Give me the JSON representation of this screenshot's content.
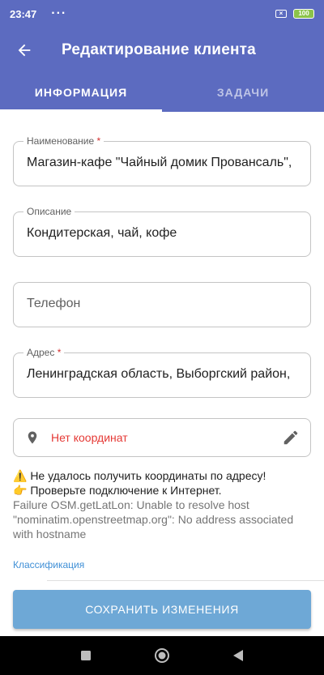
{
  "status_bar": {
    "time": "23:47",
    "dots": "···",
    "battery": "100"
  },
  "app_bar": {
    "title": "Редактирование клиента",
    "back_icon": "arrow-left-icon"
  },
  "tabs": [
    {
      "label": "ИНФОРМАЦИЯ",
      "active": true
    },
    {
      "label": "ЗАДАЧИ",
      "active": false
    }
  ],
  "form": {
    "name": {
      "label": "Наименование",
      "required": "*",
      "value": "Магазин-кафе \"Чайный домик Провансаль\","
    },
    "description": {
      "label": "Описание",
      "value": "Кондитерская, чай, кофе"
    },
    "phone": {
      "placeholder": "Телефон"
    },
    "address": {
      "label": "Адрес",
      "required": "*",
      "value": "Ленинградская область, Выборгский район,"
    },
    "coordinates": {
      "text": "Нет координат",
      "icon": "location-pin-icon",
      "edit_icon": "pencil-icon"
    }
  },
  "message": {
    "line1": "⚠️ Не удалось получить координаты по адресу!",
    "line2": "👉 Проверьте подключение к Интернет.",
    "error": "Failure OSM.getLatLon: Unable to resolve host \"nominatim.openstreetmap.org\": No address associated with hostname"
  },
  "classification_label": "Классификация",
  "save_button": "СОХРАНИТЬ ИЗМЕНЕНИЯ",
  "colors": {
    "primary": "#5c6bc0",
    "error": "#e53935",
    "link": "#3f8fd6",
    "button": "#6ea8d6"
  }
}
